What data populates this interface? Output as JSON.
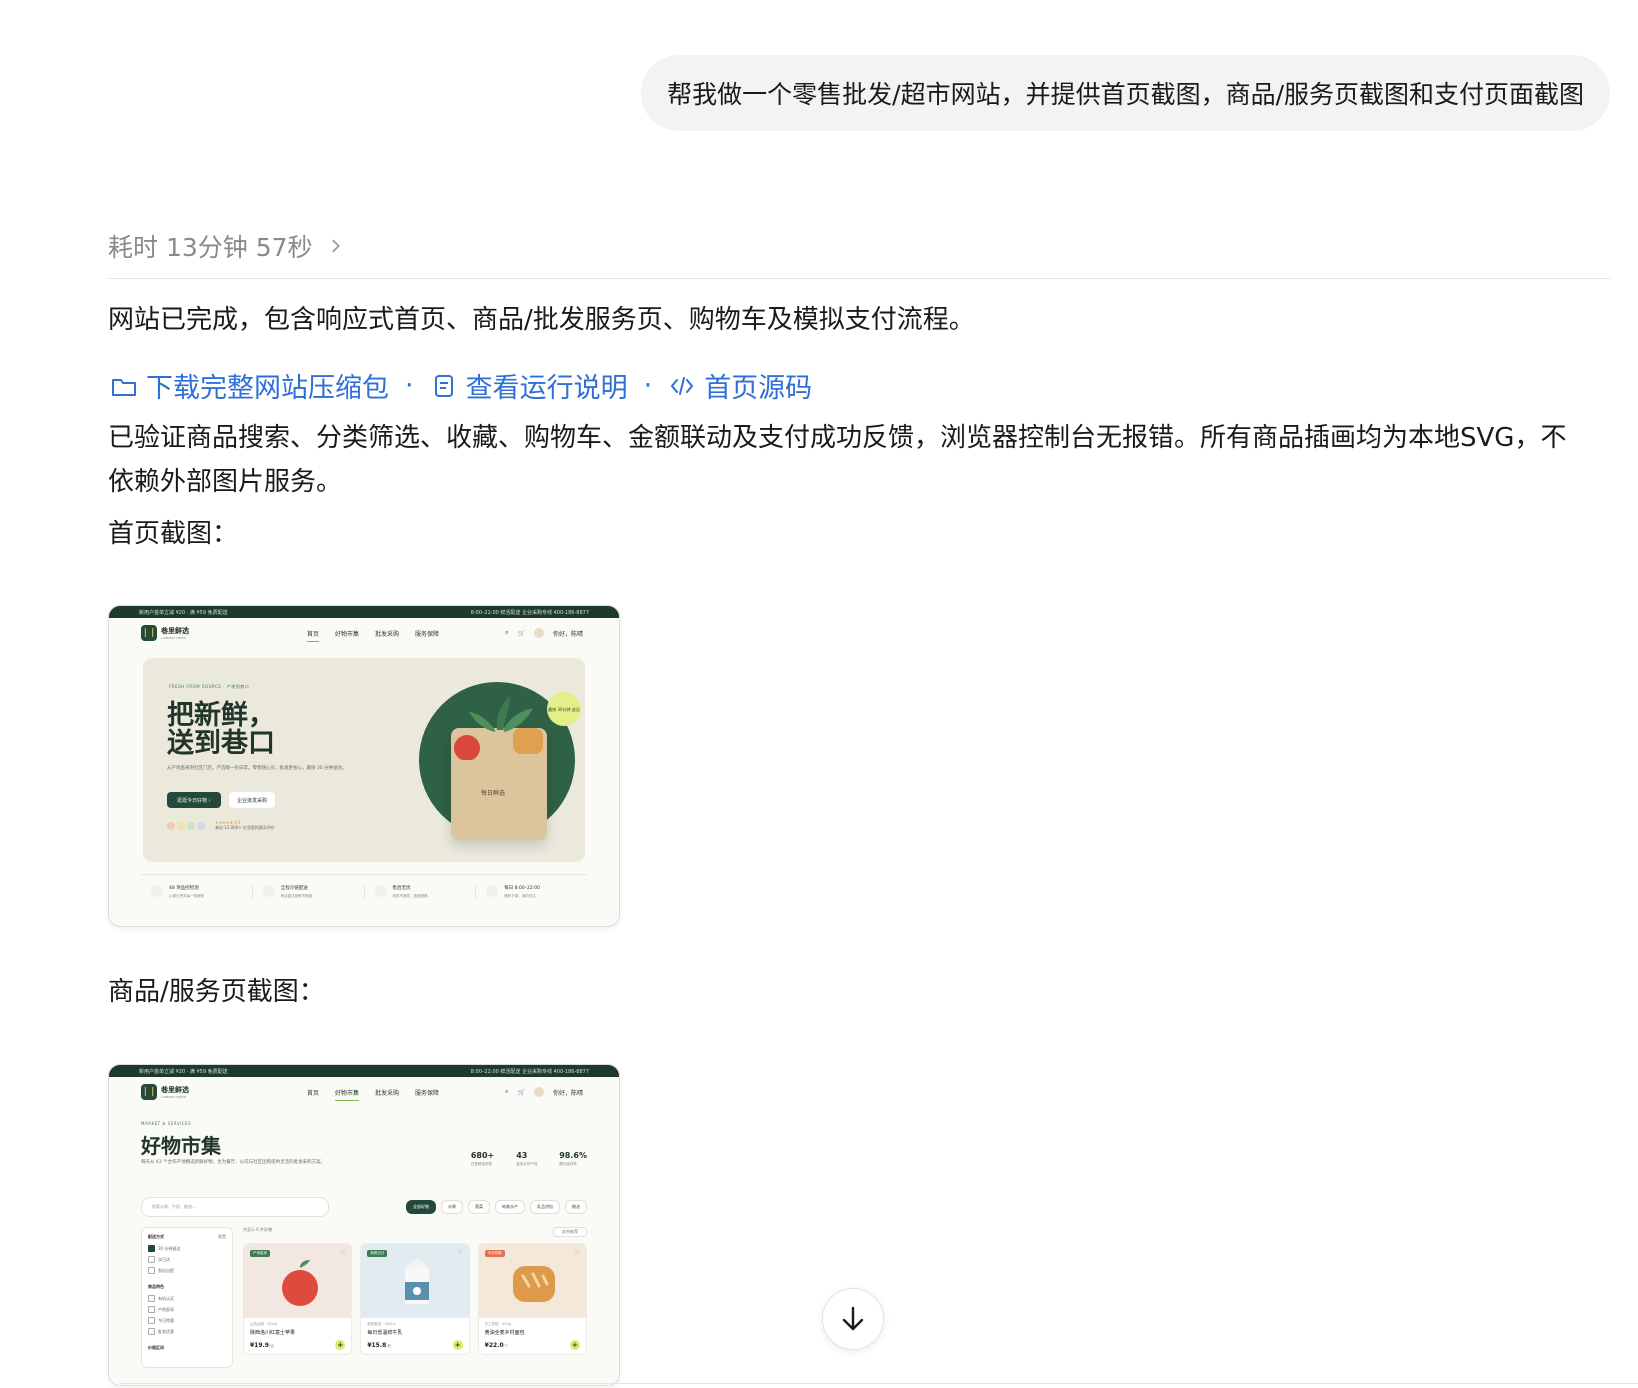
{
  "user_message": "帮我做一个零售批发/超市网站，并提供首页截图，商品/服务页截图和支付页面截图",
  "elapsed_text": "耗时 13分钟 57秒",
  "reply": {
    "line1": "网站已完成，包含响应式首页、商品/批发服务页、购物车及模拟支付流程。",
    "links": [
      {
        "label": "下载完整网站压缩包",
        "icon": "folder-icon"
      },
      {
        "label": "查看运行说明",
        "icon": "document-icon"
      },
      {
        "label": "首页源码",
        "icon": "code-icon"
      }
    ],
    "line3": "已验证商品搜索、分类筛选、收藏、购物车、金额联动及支付成功反馈，浏览器控制台无报错。所有商品插画均为本地SVG，不依赖外部图片服务。",
    "home_caption": "首页截图：",
    "product_caption": "商品/服务页截图："
  },
  "site": {
    "topbar_left": "新用户首单立减 ¥20 · 满 ¥59 免费配送",
    "topbar_right": "8:00–22:00 鲜活配送    企业采购专线 400-186-8877",
    "brand": "巷里鲜选",
    "brand_sub": "LANEWAY FRESH",
    "nav": [
      "首页",
      "好物市集",
      "批发采购",
      "服务保障"
    ],
    "greeting": "你好，陈晴",
    "home": {
      "tag": "FRESH FROM SOURCE · 产地到巷口",
      "title_line1": "把新鲜，",
      "title_line2": "送到巷口",
      "desc": "从产地直采到社区门店，严选每一份日常。零售随心买，批发更省心，最快 30 分钟送达。",
      "cta_primary": "逛逛今日好物  ›",
      "cta_secondary": "企业批发采购",
      "rating": "★★★★★ 4.9",
      "rating_sub": "来自 12,000+ 位邻里的真实评价",
      "bag_label": "每日鲜选",
      "badge": "最快 30分钟 送达",
      "features": [
        {
          "title": "48 项品控检测",
          "sub": "从源头把关每一批新鲜"
        },
        {
          "title": "全程冷链配送",
          "sub": "鲜活直达锁鲜不断链"
        },
        {
          "title": "售后无忧",
          "sub": "品质不满意，极速退换"
        },
        {
          "title": "每日 8:00–22:00",
          "sub": "随时下单，准时送达"
        }
      ]
    },
    "market": {
      "tag": "MARKET & SERVICES",
      "title": "好物市集",
      "desc": "每天从 43 个合作产地精选新鲜好物，也为餐厅、公司与社区团购提供灵活的批发采购方案。",
      "stats": [
        {
          "value": "680+",
          "label": "在售精选好物"
        },
        {
          "value": "43",
          "label": "直采合作产地"
        },
        {
          "value": "98.6%",
          "label": "履约准时率"
        }
      ],
      "search_placeholder": "搜索水果、牛奶、粮油…",
      "filters": [
        "全部好物",
        "水果",
        "蔬菜",
        "肉禽水产",
        "乳品烘焙",
        "粮油"
      ],
      "sort": "综合推荐",
      "result_meta": "共显示 6 件好物",
      "sidebar": [
        {
          "title": "配送方式",
          "action": "重置",
          "items": [
            "30 分钟速达",
            "次日达",
            "到店自提"
          ]
        },
        {
          "title": "商品特色",
          "items": [
            "有机认证",
            "产地直采",
            "今日特惠",
            "批发优惠"
          ]
        },
        {
          "title": "价格区间",
          "items": []
        }
      ],
      "cards": [
        {
          "tag": "产地直采",
          "sub": "山西运城 · 约1kg",
          "name": "陕西洛川红富士苹果",
          "price": "¥19.9",
          "unit": "/袋",
          "tag_color": "#3e7a50",
          "bg": "#f3e7e2"
        },
        {
          "tag": "新鲜当日",
          "sub": "鲜奶配送 · 950ml",
          "name": "每日低温鲜牛乳",
          "price": "¥15.8",
          "unit": "/瓶",
          "tag_color": "#3e7a50",
          "bg": "#e2ecf0"
        },
        {
          "tag": "今日特惠",
          "sub": "手工烘焙 · 450g",
          "name": "黄油全麦乡村面包",
          "price": "¥22.0",
          "unit": "/个",
          "tag_color": "#e0734f",
          "bg": "#f3e8da"
        }
      ]
    }
  }
}
